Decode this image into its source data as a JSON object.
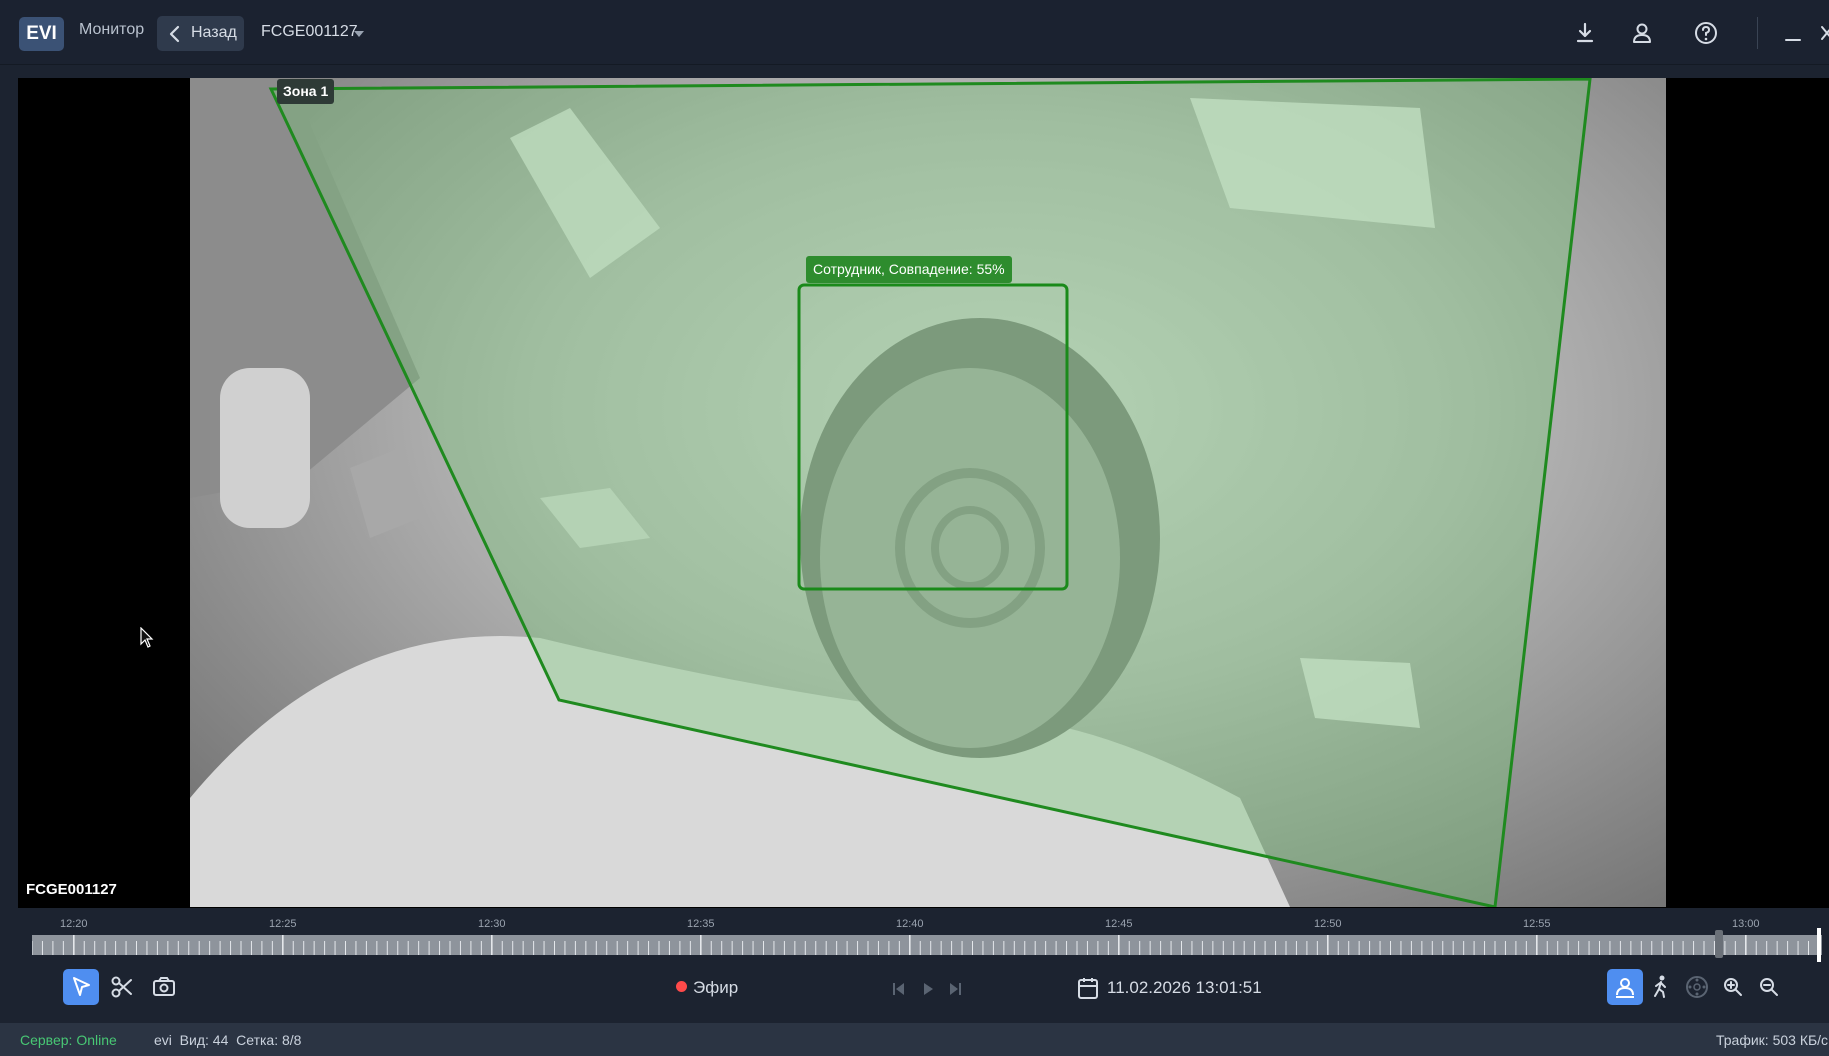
{
  "app": {
    "logo": "EVI"
  },
  "nav": {
    "monitor_label": "Монитор",
    "back_label": "Назад",
    "camera_selected": "FCGE001127"
  },
  "top_icons": [
    "download-icon",
    "user-icon",
    "help-icon",
    "minimize-icon",
    "close-icon"
  ],
  "video": {
    "camera_label": "FCGE001127",
    "zone_label": "Зона 1",
    "face_label": "Сотрудник, Совпадение: 55%",
    "zone_color": "#1f8a1f",
    "face_box_color": "#1a8a1a"
  },
  "timeline": {
    "ticks": [
      "12:20",
      "12:25",
      "12:30",
      "12:35",
      "12:40",
      "12:45",
      "12:50",
      "12:55",
      "13:00"
    ]
  },
  "controls": {
    "live_label": "Эфир",
    "datetime": "11.02.2026 13:01:51",
    "left_tools": [
      "select-icon",
      "scissors-icon",
      "camera-icon"
    ],
    "playback": [
      "skip-back-icon",
      "play-icon",
      "skip-forward-icon"
    ],
    "right_tools": [
      "face-detect-icon",
      "person-walk-icon",
      "ptz-icon",
      "zoom-in-icon",
      "zoom-out-icon"
    ]
  },
  "status": {
    "server": "Сервер: Online",
    "user_info": "evi  Вид: 44  Сетка: 8/8",
    "traffic": "Трафик: 503 КБ/с"
  },
  "colors": {
    "accent": "#4f8ef0",
    "live_dot": "#ff4a4a",
    "online": "#48c774"
  }
}
